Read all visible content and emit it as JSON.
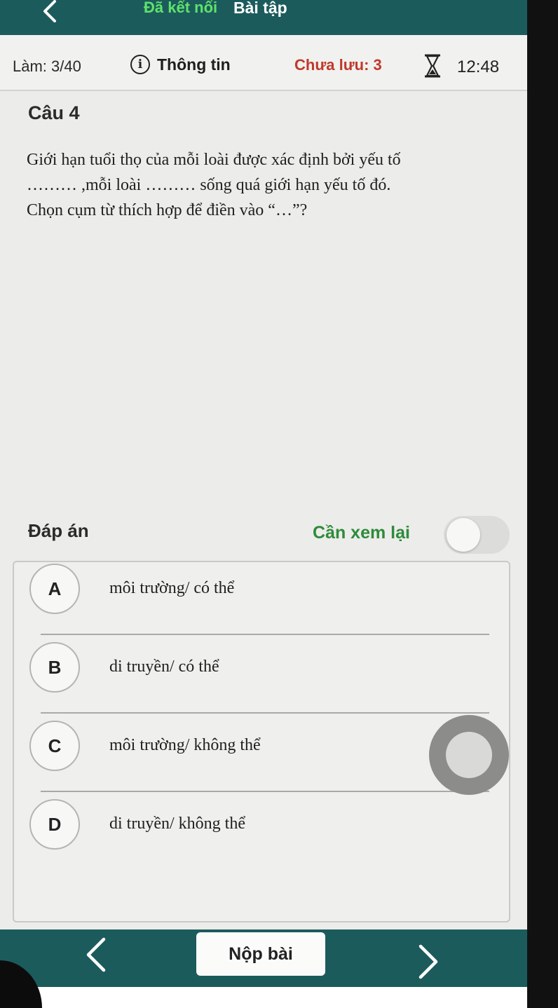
{
  "topbar": {
    "connection_status": "Đã kết nối",
    "title": "Bài tập",
    "back_icon": "chevron-left-icon"
  },
  "status": {
    "progress": "Làm: 3/40",
    "info_icon": "i",
    "info_label": "Thông tin",
    "unsaved": "Chưa lưu: 3",
    "timer": "12:48",
    "timer_icon": "hourglass-icon"
  },
  "question": {
    "label": "Câu 4",
    "lines": [
      "Giới hạn tuổi thọ của mỗi loài được xác định bởi yếu tố",
      "……… ,mỗi loài ……… sống quá giới hạn yếu tố đó.",
      "Chọn cụm từ thích hợp để điền vào “…”?"
    ]
  },
  "answers": {
    "label": "Đáp án",
    "review_label": "Cần xem lại",
    "review_toggle_on": false,
    "options": [
      {
        "letter": "A",
        "text": "môi trường/ có thể"
      },
      {
        "letter": "B",
        "text": "di truyền/ có thể"
      },
      {
        "letter": "C",
        "text": "môi trường/ không thể"
      },
      {
        "letter": "D",
        "text": "di truyền/ không thể"
      }
    ]
  },
  "bottombar": {
    "submit_label": "Nộp bài",
    "prev_icon": "chevron-left-icon",
    "next_icon": "chevron-right-icon"
  },
  "colors": {
    "primary": "#1c5b5c",
    "connected": "#5ee36b",
    "unsaved": "#c0392b",
    "review": "#2e8b3a"
  }
}
